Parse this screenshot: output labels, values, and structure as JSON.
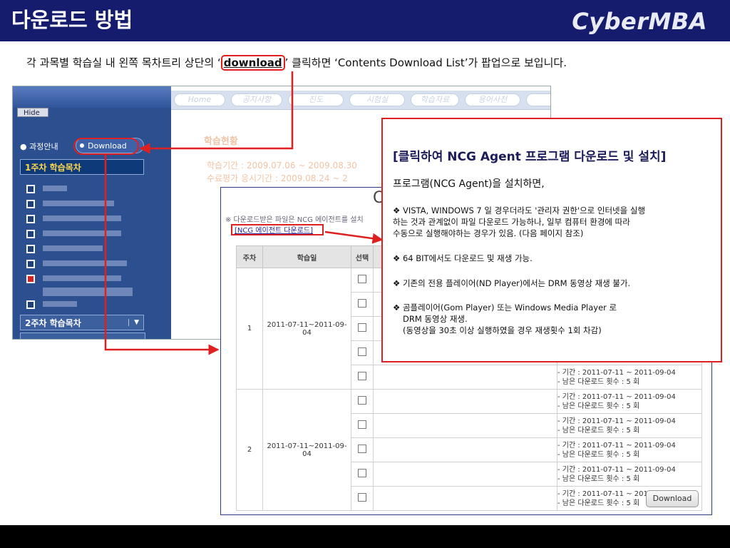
{
  "slide": {
    "title": "다운로드 방법",
    "brand": "CyberMBA",
    "desc_before": "각 과목별 학습실 내 왼쪽 목차트리 상단의 ‘",
    "desc_highlight": "download",
    "desc_after": "’ 클릭하면 ‘Contents Download List’가 팝업으로 보입니다."
  },
  "lms": {
    "hide_label": "Hide",
    "tab_course_info": "과정안내",
    "tab_download": "Download",
    "week1_label": "1주차 학습목차",
    "week2_label": "2주차 학습목차",
    "nav": [
      "Home",
      "공지사항",
      "진도",
      "시험실",
      "학습자료",
      "용어사전"
    ],
    "faded_heading": "학습현황",
    "faded_line1": "학습기간 : 2009.07.06 ~ 2009.08.30",
    "faded_line2": "수료평가 응시기간 : 2009.08.24 ~ 2"
  },
  "popup": {
    "big_char": "C",
    "note": "※ 다운로드받은 파일은 NCG 에이전트를 설치",
    "agent_link": "[NCG 에이전트 다운로드]",
    "headers": [
      "주차",
      "학습일",
      "선택"
    ],
    "groups": [
      {
        "week": "1",
        "period": "2011-07-11~2011-09-04"
      },
      {
        "week": "2",
        "period": "2011-07-11~2011-09-04"
      }
    ],
    "info_period": "- 기간 : 2011-07-11 ~ 2011-09-04",
    "info_remaining": "- 남은 다운로드 횟수 : 5 회",
    "download_button": "Download"
  },
  "callout": {
    "title": "[클릭하여 NCG Agent 프로그램 다운로드 및 설치]",
    "subtitle": "프로그램(NCG Agent)을 설치하면,",
    "b1_l1": "❖ VISTA, WINDOWS 7 일 경우더라도 '관리자 권한'으로 인터넷을 실행",
    "b1_l2": "하는 것과 관계없이 파일 다운로드 가능하나, 일부 컴퓨터 환경에 따라",
    "b1_l3": "수동으로 실행해야하는 경우가 있음. (다음 페이지 참조)",
    "b2": "❖ 64 BIT에서도 다운로드 및 재생 가능.",
    "b3": "❖ 기존의 전용 플레이어(ND Player)에서는 DRM 동영상 재생 불가.",
    "b4_l1": "❖ 곰플레이어(Gom Player) 또는 Windows Media Player 로",
    "b4_l2": "DRM 동영상 재생.",
    "b4_l3": "(동영상을 30초 이상 실행하였을 경우 재생횟수 1회 차감)"
  },
  "colors": {
    "header_bg": "#151b6d",
    "accent_red": "#e02020",
    "sidebar_bg": "#2c4f90",
    "week_label": "#ffd84a"
  }
}
